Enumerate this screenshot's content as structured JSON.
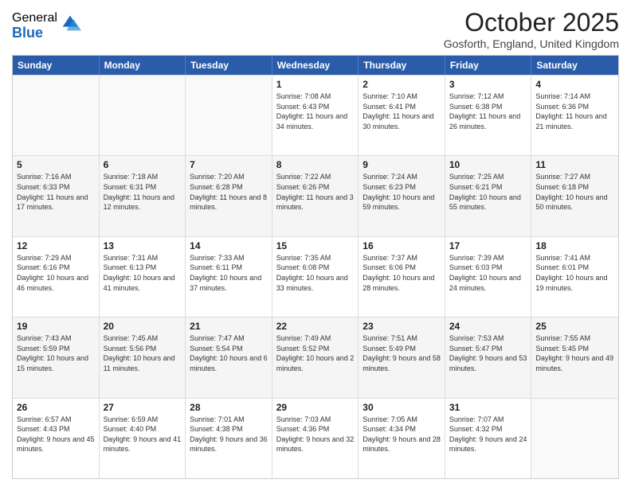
{
  "logo": {
    "general": "General",
    "blue": "Blue"
  },
  "title": "October 2025",
  "subtitle": "Gosforth, England, United Kingdom",
  "days_of_week": [
    "Sunday",
    "Monday",
    "Tuesday",
    "Wednesday",
    "Thursday",
    "Friday",
    "Saturday"
  ],
  "weeks": [
    [
      {
        "day": "",
        "sunrise": "",
        "sunset": "",
        "daylight": ""
      },
      {
        "day": "",
        "sunrise": "",
        "sunset": "",
        "daylight": ""
      },
      {
        "day": "",
        "sunrise": "",
        "sunset": "",
        "daylight": ""
      },
      {
        "day": "1",
        "sunrise": "Sunrise: 7:08 AM",
        "sunset": "Sunset: 6:43 PM",
        "daylight": "Daylight: 11 hours and 34 minutes."
      },
      {
        "day": "2",
        "sunrise": "Sunrise: 7:10 AM",
        "sunset": "Sunset: 6:41 PM",
        "daylight": "Daylight: 11 hours and 30 minutes."
      },
      {
        "day": "3",
        "sunrise": "Sunrise: 7:12 AM",
        "sunset": "Sunset: 6:38 PM",
        "daylight": "Daylight: 11 hours and 26 minutes."
      },
      {
        "day": "4",
        "sunrise": "Sunrise: 7:14 AM",
        "sunset": "Sunset: 6:36 PM",
        "daylight": "Daylight: 11 hours and 21 minutes."
      }
    ],
    [
      {
        "day": "5",
        "sunrise": "Sunrise: 7:16 AM",
        "sunset": "Sunset: 6:33 PM",
        "daylight": "Daylight: 11 hours and 17 minutes."
      },
      {
        "day": "6",
        "sunrise": "Sunrise: 7:18 AM",
        "sunset": "Sunset: 6:31 PM",
        "daylight": "Daylight: 11 hours and 12 minutes."
      },
      {
        "day": "7",
        "sunrise": "Sunrise: 7:20 AM",
        "sunset": "Sunset: 6:28 PM",
        "daylight": "Daylight: 11 hours and 8 minutes."
      },
      {
        "day": "8",
        "sunrise": "Sunrise: 7:22 AM",
        "sunset": "Sunset: 6:26 PM",
        "daylight": "Daylight: 11 hours and 3 minutes."
      },
      {
        "day": "9",
        "sunrise": "Sunrise: 7:24 AM",
        "sunset": "Sunset: 6:23 PM",
        "daylight": "Daylight: 10 hours and 59 minutes."
      },
      {
        "day": "10",
        "sunrise": "Sunrise: 7:25 AM",
        "sunset": "Sunset: 6:21 PM",
        "daylight": "Daylight: 10 hours and 55 minutes."
      },
      {
        "day": "11",
        "sunrise": "Sunrise: 7:27 AM",
        "sunset": "Sunset: 6:18 PM",
        "daylight": "Daylight: 10 hours and 50 minutes."
      }
    ],
    [
      {
        "day": "12",
        "sunrise": "Sunrise: 7:29 AM",
        "sunset": "Sunset: 6:16 PM",
        "daylight": "Daylight: 10 hours and 46 minutes."
      },
      {
        "day": "13",
        "sunrise": "Sunrise: 7:31 AM",
        "sunset": "Sunset: 6:13 PM",
        "daylight": "Daylight: 10 hours and 41 minutes."
      },
      {
        "day": "14",
        "sunrise": "Sunrise: 7:33 AM",
        "sunset": "Sunset: 6:11 PM",
        "daylight": "Daylight: 10 hours and 37 minutes."
      },
      {
        "day": "15",
        "sunrise": "Sunrise: 7:35 AM",
        "sunset": "Sunset: 6:08 PM",
        "daylight": "Daylight: 10 hours and 33 minutes."
      },
      {
        "day": "16",
        "sunrise": "Sunrise: 7:37 AM",
        "sunset": "Sunset: 6:06 PM",
        "daylight": "Daylight: 10 hours and 28 minutes."
      },
      {
        "day": "17",
        "sunrise": "Sunrise: 7:39 AM",
        "sunset": "Sunset: 6:03 PM",
        "daylight": "Daylight: 10 hours and 24 minutes."
      },
      {
        "day": "18",
        "sunrise": "Sunrise: 7:41 AM",
        "sunset": "Sunset: 6:01 PM",
        "daylight": "Daylight: 10 hours and 19 minutes."
      }
    ],
    [
      {
        "day": "19",
        "sunrise": "Sunrise: 7:43 AM",
        "sunset": "Sunset: 5:59 PM",
        "daylight": "Daylight: 10 hours and 15 minutes."
      },
      {
        "day": "20",
        "sunrise": "Sunrise: 7:45 AM",
        "sunset": "Sunset: 5:56 PM",
        "daylight": "Daylight: 10 hours and 11 minutes."
      },
      {
        "day": "21",
        "sunrise": "Sunrise: 7:47 AM",
        "sunset": "Sunset: 5:54 PM",
        "daylight": "Daylight: 10 hours and 6 minutes."
      },
      {
        "day": "22",
        "sunrise": "Sunrise: 7:49 AM",
        "sunset": "Sunset: 5:52 PM",
        "daylight": "Daylight: 10 hours and 2 minutes."
      },
      {
        "day": "23",
        "sunrise": "Sunrise: 7:51 AM",
        "sunset": "Sunset: 5:49 PM",
        "daylight": "Daylight: 9 hours and 58 minutes."
      },
      {
        "day": "24",
        "sunrise": "Sunrise: 7:53 AM",
        "sunset": "Sunset: 5:47 PM",
        "daylight": "Daylight: 9 hours and 53 minutes."
      },
      {
        "day": "25",
        "sunrise": "Sunrise: 7:55 AM",
        "sunset": "Sunset: 5:45 PM",
        "daylight": "Daylight: 9 hours and 49 minutes."
      }
    ],
    [
      {
        "day": "26",
        "sunrise": "Sunrise: 6:57 AM",
        "sunset": "Sunset: 4:43 PM",
        "daylight": "Daylight: 9 hours and 45 minutes."
      },
      {
        "day": "27",
        "sunrise": "Sunrise: 6:59 AM",
        "sunset": "Sunset: 4:40 PM",
        "daylight": "Daylight: 9 hours and 41 minutes."
      },
      {
        "day": "28",
        "sunrise": "Sunrise: 7:01 AM",
        "sunset": "Sunset: 4:38 PM",
        "daylight": "Daylight: 9 hours and 36 minutes."
      },
      {
        "day": "29",
        "sunrise": "Sunrise: 7:03 AM",
        "sunset": "Sunset: 4:36 PM",
        "daylight": "Daylight: 9 hours and 32 minutes."
      },
      {
        "day": "30",
        "sunrise": "Sunrise: 7:05 AM",
        "sunset": "Sunset: 4:34 PM",
        "daylight": "Daylight: 9 hours and 28 minutes."
      },
      {
        "day": "31",
        "sunrise": "Sunrise: 7:07 AM",
        "sunset": "Sunset: 4:32 PM",
        "daylight": "Daylight: 9 hours and 24 minutes."
      },
      {
        "day": "",
        "sunrise": "",
        "sunset": "",
        "daylight": ""
      }
    ]
  ]
}
